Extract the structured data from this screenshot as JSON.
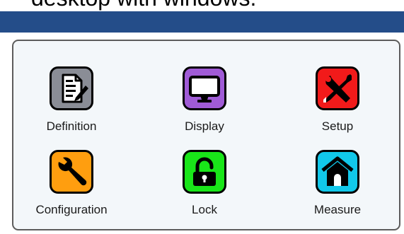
{
  "caption": "desktop with windows.",
  "menu": {
    "tiles": [
      {
        "label": "Definition",
        "icon": "document-edit-icon",
        "color": "#8a8d96"
      },
      {
        "label": "Display",
        "icon": "monitor-icon",
        "color": "#a05bd6"
      },
      {
        "label": "Setup",
        "icon": "tools-icon",
        "color": "#f21a1a"
      },
      {
        "label": "Configuration",
        "icon": "wrench-icon",
        "color": "#ff9e0f"
      },
      {
        "label": "Lock",
        "icon": "padlock-icon",
        "color": "#19e619"
      },
      {
        "label": "Measure",
        "icon": "home-icon",
        "color": "#11c8ea"
      }
    ]
  },
  "colors": {
    "title_bar": "#244d89",
    "panel_background": "#f3f7fa",
    "panel_border": "#5c5c5c"
  }
}
